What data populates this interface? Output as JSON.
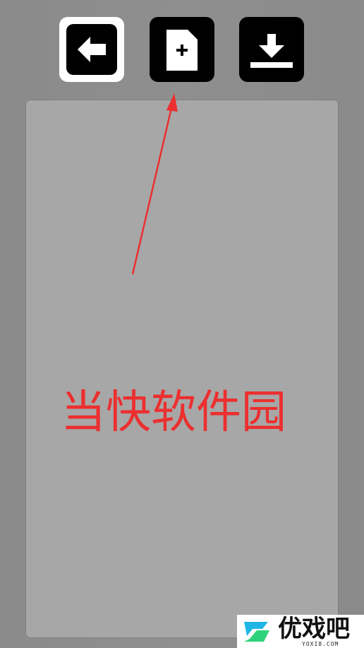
{
  "toolbar": {
    "buttons": [
      {
        "id": "back",
        "icon": "arrow-left-icon",
        "state": "active"
      },
      {
        "id": "new",
        "icon": "new-file-icon",
        "state": "normal"
      },
      {
        "id": "download",
        "icon": "download-icon",
        "state": "normal"
      }
    ]
  },
  "annotation": {
    "text": "当快软件园",
    "color": "#ec2f2f"
  },
  "watermark": {
    "name": "优戏吧",
    "domain": "YOXI8.COM",
    "colors": [
      "#1fb6e6",
      "#2fd27a"
    ]
  }
}
